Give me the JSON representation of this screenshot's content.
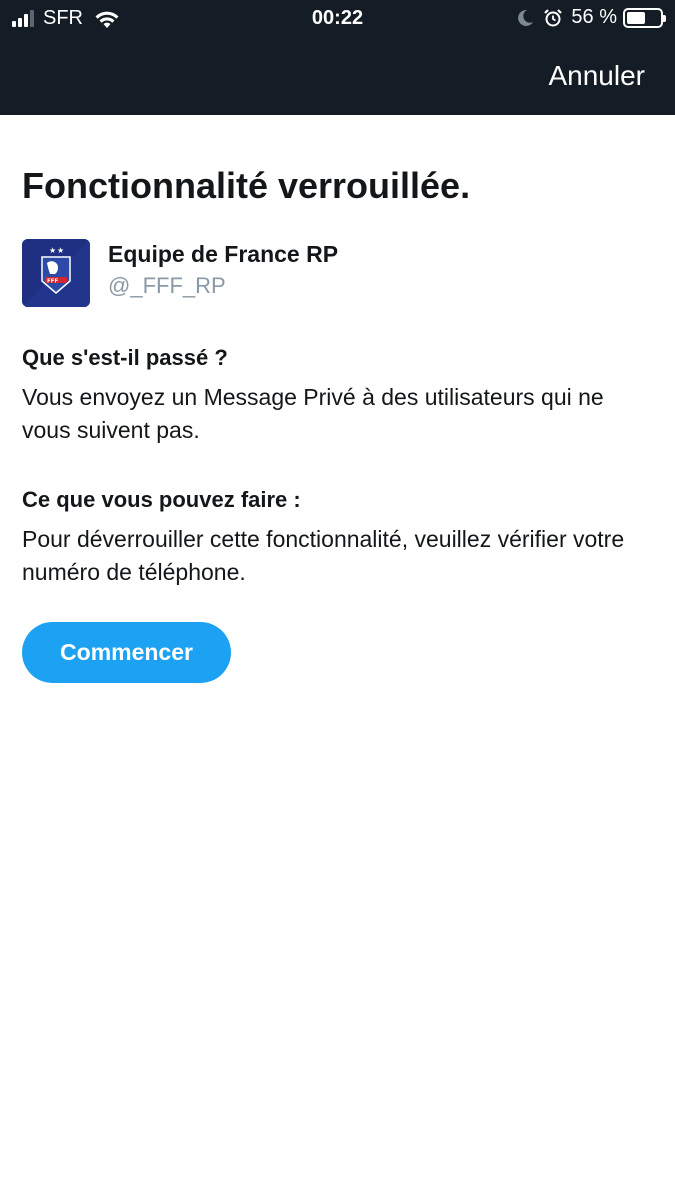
{
  "status_bar": {
    "carrier": "SFR",
    "time": "00:22",
    "battery_percent": "56 %",
    "battery_level": 0.56,
    "icons": [
      "signal-icon",
      "wifi-icon",
      "moon-icon",
      "alarm-icon",
      "battery-icon"
    ]
  },
  "header": {
    "cancel_label": "Annuler"
  },
  "main": {
    "title": "Fonctionnalité verrouillée.",
    "account": {
      "name": "Equipe de France RP",
      "handle": "@_FFF_RP"
    },
    "section_what_happened": {
      "heading": "Que s'est-il passé ?",
      "body": "Vous envoyez un Message Privé à des utilisateurs qui ne vous suivent pas."
    },
    "section_what_to_do": {
      "heading": "Ce que vous pouvez faire :",
      "body": "Pour déverrouiller cette fonctionnalité, veuillez vérifier votre numéro de téléphone."
    },
    "start_button_label": "Commencer"
  },
  "colors": {
    "header_bg": "#141d26",
    "accent": "#1da1f2",
    "handle": "#8a99a6",
    "avatar_bg": "#1f2f82"
  }
}
